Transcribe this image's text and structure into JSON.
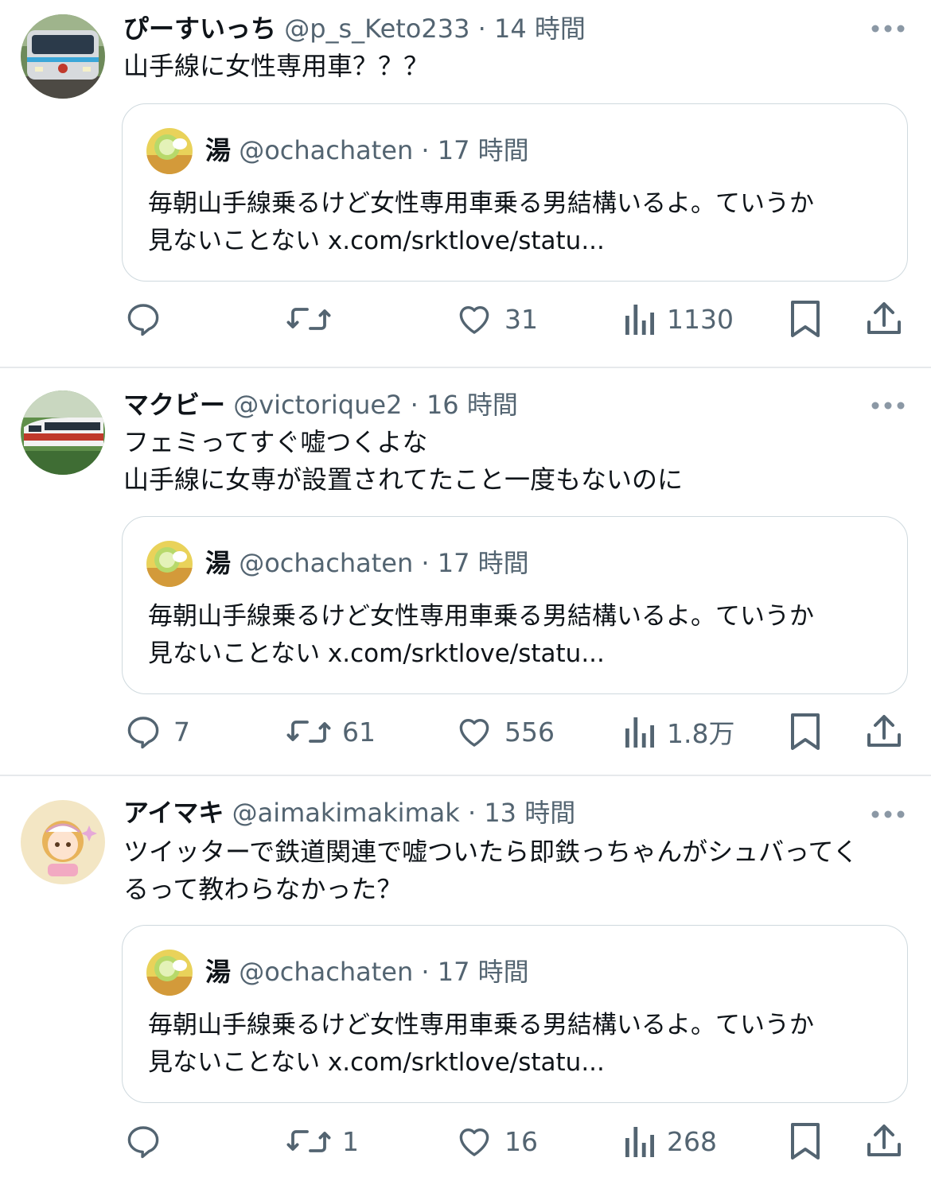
{
  "tweets": [
    {
      "author_name": "ぴーすいっち",
      "handle": "@p_s_Keto233",
      "separator": "·",
      "time": "14 時間",
      "avatar_icon": "train-photo-avatar",
      "text": "山手線に女性専用車？？？",
      "quote": {
        "author_name": "湯",
        "handle": "@ochachaten",
        "separator": "·",
        "time": "17 時間",
        "text": "毎朝山手線乗るけど女性専用車乗る男結構いるよ。ていうか\n見ないことない x.com/srktlove/statu..."
      },
      "actions": {
        "replies": "",
        "retweets": "",
        "likes": "31",
        "views": "1130"
      }
    },
    {
      "author_name": "マクビー",
      "handle": "@victorique2",
      "separator": "·",
      "time": "16 時間",
      "avatar_icon": "express-train-photo-avatar",
      "text": "フェミってすぐ嘘つくよな\n山手線に女専が設置されてたこと一度もないのに",
      "quote": {
        "author_name": "湯",
        "handle": "@ochachaten",
        "separator": "·",
        "time": "17 時間",
        "text": "毎朝山手線乗るけど女性専用車乗る男結構いるよ。ていうか\n見ないことない x.com/srktlove/statu..."
      },
      "actions": {
        "replies": "7",
        "retweets": "61",
        "likes": "556",
        "views": "1.8万"
      }
    },
    {
      "author_name": "アイマキ",
      "handle": "@aimakimakimak",
      "separator": "·",
      "time": "13 時間",
      "avatar_icon": "anime-character-avatar",
      "text": "ツイッターで鉄道関連で嘘ついたら即鉄っちゃんがシュバってく\nるって教わらなかった？",
      "quote": {
        "author_name": "湯",
        "handle": "@ochachaten",
        "separator": "·",
        "time": "17 時間",
        "text": "毎朝山手線乗るけど女性専用車乗る男結構いるよ。ていうか\n見ないことない x.com/srktlove/statu..."
      },
      "actions": {
        "replies": "",
        "retweets": "1",
        "likes": "16",
        "views": "268"
      }
    }
  ],
  "colors": {
    "text_primary": "#0f1419",
    "text_secondary": "#536471",
    "border": "#cfd9de",
    "divider": "#e6e9ec"
  },
  "icons": {
    "reply": "reply-icon",
    "retweet": "retweet-icon",
    "like": "like-icon",
    "views": "views-icon",
    "bookmark": "bookmark-icon",
    "share": "share-icon",
    "more": "more-icon"
  }
}
